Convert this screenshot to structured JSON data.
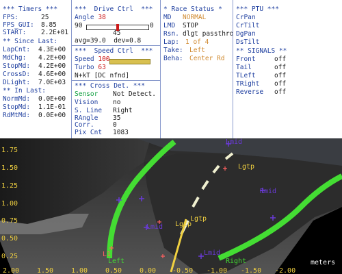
{
  "timers": {
    "header": "*** Timers ***",
    "rows": [
      {
        "label": "FPS:",
        "value": "25"
      },
      {
        "label": "FPS_GUI:",
        "value": "8.85"
      },
      {
        "label": "START:",
        "value": "2.2E+01"
      }
    ],
    "since_header": "** Since Last:",
    "since_rows": [
      {
        "label": "LapCnt:",
        "value": "4.3E+00"
      },
      {
        "label": "MdChg:",
        "value": "4.2E+00"
      },
      {
        "label": "StopMd:",
        "value": "4.2E+00"
      },
      {
        "label": "CrossD:",
        "value": "4.6E+00"
      },
      {
        "label": "DLight:",
        "value": "7.0E+03"
      }
    ],
    "in_header": "** In Last:",
    "in_rows": [
      {
        "label": "NormMd:",
        "value": "0.0E+00"
      },
      {
        "label": "StopMd:",
        "value": "1.1E-01"
      },
      {
        "label": "RdMtMd:",
        "value": "0.0E+00"
      }
    ]
  },
  "drive": {
    "header": "***  Drive Ctrl  ***",
    "angle_label": "Angle",
    "angle_value": "38",
    "slider_min": "90",
    "slider_max": "0",
    "slider_fraction": 0.5,
    "slider_center": "45",
    "stats": "avg=39.0  dev=0.8",
    "speed_header": "***  Speed Ctrl  ***",
    "speed_label": "Speed",
    "speed_value": "100",
    "turbo_label": "Turbo",
    "turbo_value": "63",
    "mode_text": "N+kT [DC nfnd]",
    "cross_header": "*** Cross Det. ***",
    "cross_rows": [
      {
        "label": "Sensor",
        "value": "Not Detect."
      },
      {
        "label": "Vision",
        "value": "no"
      },
      {
        "label": "S. Line",
        "value": "Right"
      },
      {
        "label": "RAngle",
        "value": "35"
      },
      {
        "label": "Corr.",
        "value": "0"
      },
      {
        "label": "Pix Cnt",
        "value": "1083"
      }
    ]
  },
  "race": {
    "header": "* Race Status *",
    "rows": [
      {
        "label": "MD",
        "value": "NORMAL"
      },
      {
        "label": "LMD",
        "value": "STOP"
      },
      {
        "label": "Rsn.",
        "value": "dlgt passthro"
      },
      {
        "label": "Lap:",
        "value": "1 of 4"
      },
      {
        "label": "Take:",
        "value": "Left"
      },
      {
        "label": "Beha:",
        "value": "Center Rd"
      }
    ]
  },
  "ptu": {
    "header": "*** PTU ***",
    "rows": [
      "CrPan",
      "CrTilt",
      "DgPan",
      "DsTilt"
    ],
    "signals_header": "** SIGNALS **",
    "signals": [
      {
        "label": "Front",
        "value": "off"
      },
      {
        "label": "Tail",
        "value": "off"
      },
      {
        "label": "TLeft",
        "value": "off"
      },
      {
        "label": "TRight",
        "value": "off"
      },
      {
        "label": "Reverse",
        "value": "off"
      }
    ]
  },
  "view": {
    "y_ticks": [
      "1.75",
      "1.50",
      "1.25",
      "1.00",
      "0.75",
      "0.50",
      "0.25"
    ],
    "x_ticks": [
      "2.00",
      "1.50",
      "1.00",
      "0.50",
      "0.00",
      "-0.50",
      "-1.00",
      "-1.50",
      "-2.00"
    ],
    "unit": "meters",
    "labels": {
      "lmid_top": "Lmid",
      "lgtp_top": "Lgtp",
      "rmid": "Rmid",
      "lmid_left": "Lmid",
      "lgtp_mid": "Lgtp",
      "lgtp_low": "Lgtp",
      "lmid_bottom": "Lmid",
      "left": "Left",
      "right": "Right",
      "l1": "L1"
    },
    "colors": {
      "lane_line": "#44dd33",
      "marker": "#6a3ad8",
      "text_yellow": "#f0d040",
      "label_blue": "#6a3ad8"
    }
  }
}
